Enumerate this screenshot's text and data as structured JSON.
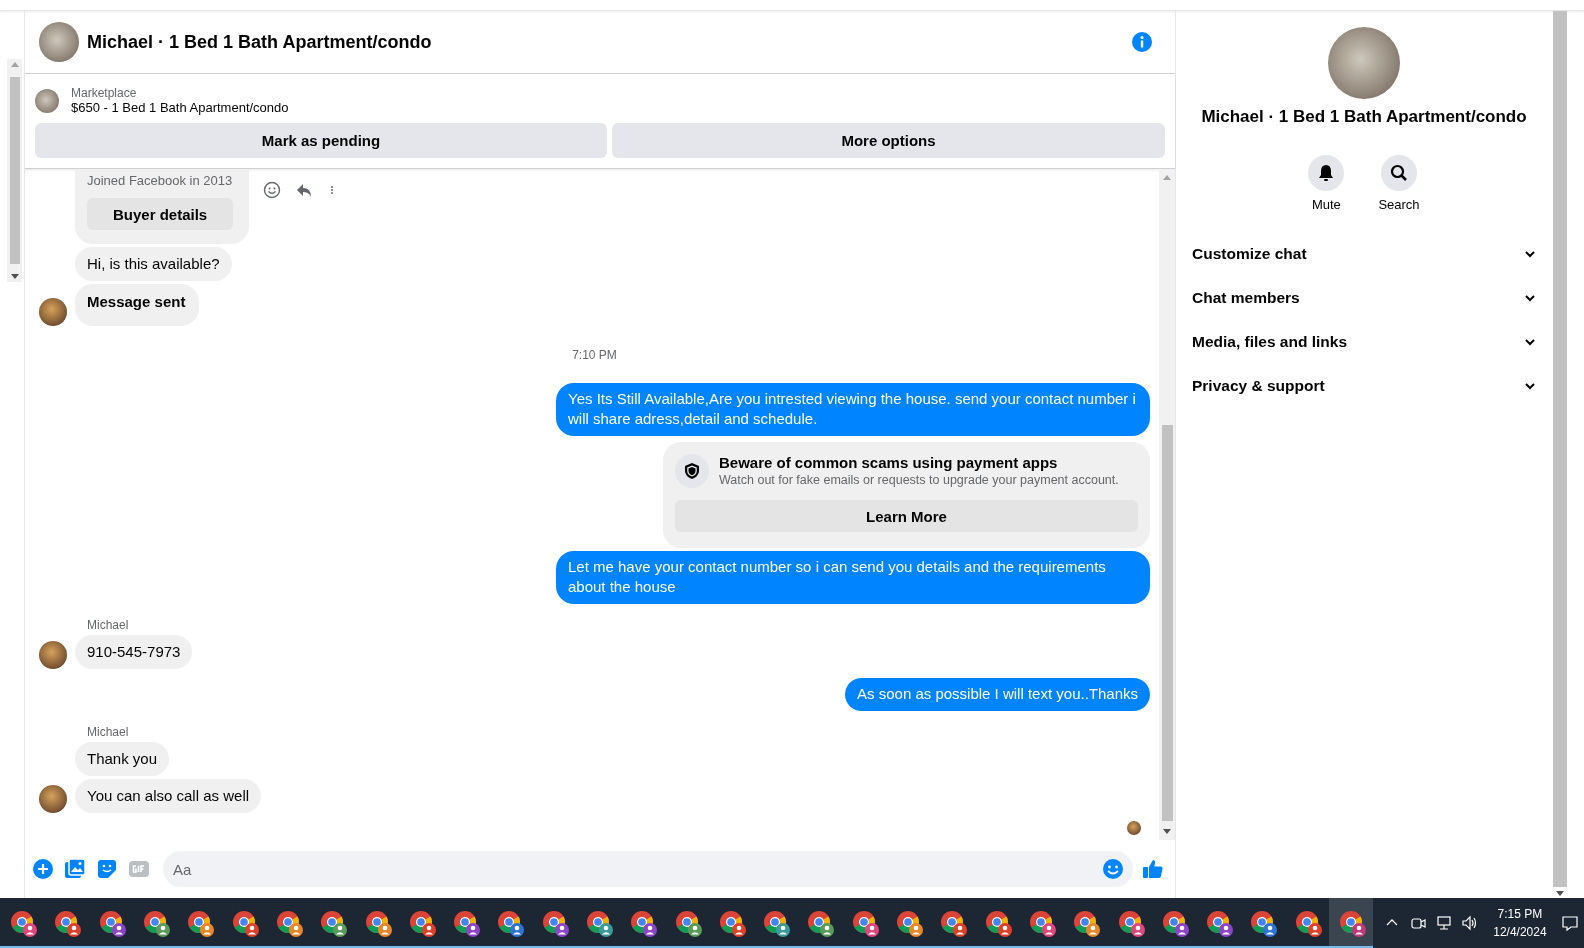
{
  "header": {
    "title": "Michael · 1 Bed 1 Bath Apartment/condo"
  },
  "listing": {
    "source": "Marketplace",
    "title": "$650 - 1 Bed 1 Bath Apartment/condo",
    "actions": [
      "Mark as pending",
      "More options"
    ]
  },
  "messages": [
    {
      "kind": "profile_card",
      "text": "Joined Facebook in 2013",
      "button": "Buyer details"
    },
    {
      "kind": "incoming",
      "text": "Hi, is this available?",
      "avatar": false,
      "bold": false
    },
    {
      "kind": "incoming",
      "text": "Message sent",
      "avatar": true,
      "bold": true
    },
    {
      "kind": "time",
      "text": "7:10 PM"
    },
    {
      "kind": "outgoing",
      "text": "Yes Its Still Available,Are you intrested viewing the house. send your contact number i will share adress,detail and schedule."
    },
    {
      "kind": "notice",
      "title": "Beware of common scams using payment apps",
      "text": "Watch out for fake emails or requests to upgrade your payment account.",
      "button": "Learn More"
    },
    {
      "kind": "outgoing",
      "text": "Let me have your contact number so i can send you details and the requirements about the house"
    },
    {
      "kind": "sender",
      "text": "Michael"
    },
    {
      "kind": "incoming",
      "text": "910-545-7973",
      "avatar": true,
      "bold": false
    },
    {
      "kind": "outgoing",
      "text": "As soon as possible I will text you..Thanks"
    },
    {
      "kind": "sender",
      "text": "Michael"
    },
    {
      "kind": "incoming",
      "text": "Thank you",
      "avatar": false,
      "bold": false
    },
    {
      "kind": "incoming",
      "text": "You can also call as well",
      "avatar": true,
      "bold": false
    },
    {
      "kind": "seen"
    }
  ],
  "composer": {
    "placeholder": "Aa"
  },
  "details": {
    "title": "Michael · 1 Bed 1 Bath Apartment/condo",
    "actions": [
      {
        "kind": "bell",
        "label": "Mute"
      },
      {
        "kind": "search",
        "label": "Search"
      }
    ],
    "sections": [
      {
        "label": "Customize chat",
        "expanded": false
      },
      {
        "label": "Chat members",
        "expanded": false
      },
      {
        "label": "Media, files and links",
        "expanded": false
      },
      {
        "label": "Privacy & support",
        "expanded": false
      }
    ]
  },
  "taskbar": {
    "apps": [
      {
        "color": "#e0457b",
        "selected": false
      },
      {
        "color": "#e0402a",
        "selected": false
      },
      {
        "color": "#8e44c9",
        "selected": false
      },
      {
        "color": "#5a9a5a",
        "selected": false
      },
      {
        "color": "#e8872a",
        "selected": false
      },
      {
        "color": "#e0402a",
        "selected": false
      },
      {
        "color": "#e8872a",
        "selected": false
      },
      {
        "color": "#5a9a5a",
        "selected": false
      },
      {
        "color": "#e8872a",
        "selected": false
      },
      {
        "color": "#e0402a",
        "selected": false
      },
      {
        "color": "#8e44c9",
        "selected": false
      },
      {
        "color": "#2e74d6",
        "selected": false
      },
      {
        "color": "#8e44c9",
        "selected": false
      },
      {
        "color": "#3a9a9a",
        "selected": false
      },
      {
        "color": "#8e44c9",
        "selected": false
      },
      {
        "color": "#5a9a5a",
        "selected": false
      },
      {
        "color": "#e0402a",
        "selected": false
      },
      {
        "color": "#3a9a9a",
        "selected": false
      },
      {
        "color": "#5a9a5a",
        "selected": false
      },
      {
        "color": "#e0457b",
        "selected": false
      },
      {
        "color": "#e8872a",
        "selected": false
      },
      {
        "color": "#e0402a",
        "selected": false
      },
      {
        "color": "#e0402a",
        "selected": false
      },
      {
        "color": "#e0457b",
        "selected": false
      },
      {
        "color": "#e8872a",
        "selected": false
      },
      {
        "color": "#e0457b",
        "selected": false
      },
      {
        "color": "#8e44c9",
        "selected": false
      },
      {
        "color": "#8e44c9",
        "selected": false
      },
      {
        "color": "#2e74d6",
        "selected": false
      },
      {
        "color": "#e0402a",
        "selected": false
      },
      {
        "color": "#c2387d",
        "selected": true
      }
    ],
    "clock": {
      "time": "7:15 PM",
      "date": "12/4/2024"
    }
  }
}
